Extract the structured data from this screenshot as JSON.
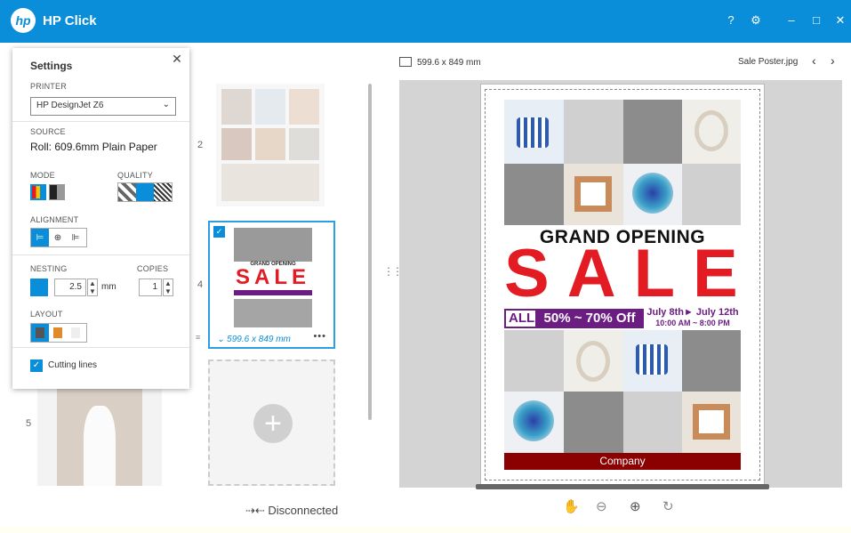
{
  "app": {
    "title": "HP Click",
    "logo": "hp"
  },
  "window_buttons": [
    "?",
    "⚙",
    "–",
    "□",
    "✕"
  ],
  "settings": {
    "title": "Settings",
    "printer_label": "PRINTER",
    "printer_value": "HP DesignJet Z6",
    "source_label": "SOURCE",
    "source_value": "Roll: 609.6mm Plain Paper",
    "mode_label": "MODE",
    "quality_label": "QUALITY",
    "alignment_label": "ALIGNMENT",
    "nesting_label": "NESTING",
    "nesting_value": "2.5",
    "nesting_unit": "mm",
    "copies_label": "COPIES",
    "copies_value": "1",
    "layout_label": "LAYOUT",
    "cutting_lines_label": "Cutting lines",
    "cutting_lines_checked": true
  },
  "jobs": [
    {
      "number": "2"
    },
    {
      "number": "4",
      "size": "599.6 x 849 mm",
      "selected": true
    },
    {
      "number": "5"
    }
  ],
  "connection_status": "Disconnected",
  "preview": {
    "dimensions": "599.6 x 849 mm",
    "file_name": "Sale Poster.jpg",
    "prev": "‹",
    "next": "›"
  },
  "poster": {
    "headline": "GRAND OPENING",
    "sale": "SALE",
    "all": "ALL",
    "discount": "50% ~ 70% Off",
    "dates": "July 8th► July 12th",
    "hours": "10:00 AM ~ 8:00 PM",
    "company": "Company"
  },
  "thumb_poster": {
    "headline": "GRAND OPENING",
    "sale": "SALE"
  },
  "colors": {
    "accent": "#0a8ed9",
    "sale_red": "#e31b23",
    "purple": "#6b1d82",
    "company_bar": "#8b0000"
  }
}
